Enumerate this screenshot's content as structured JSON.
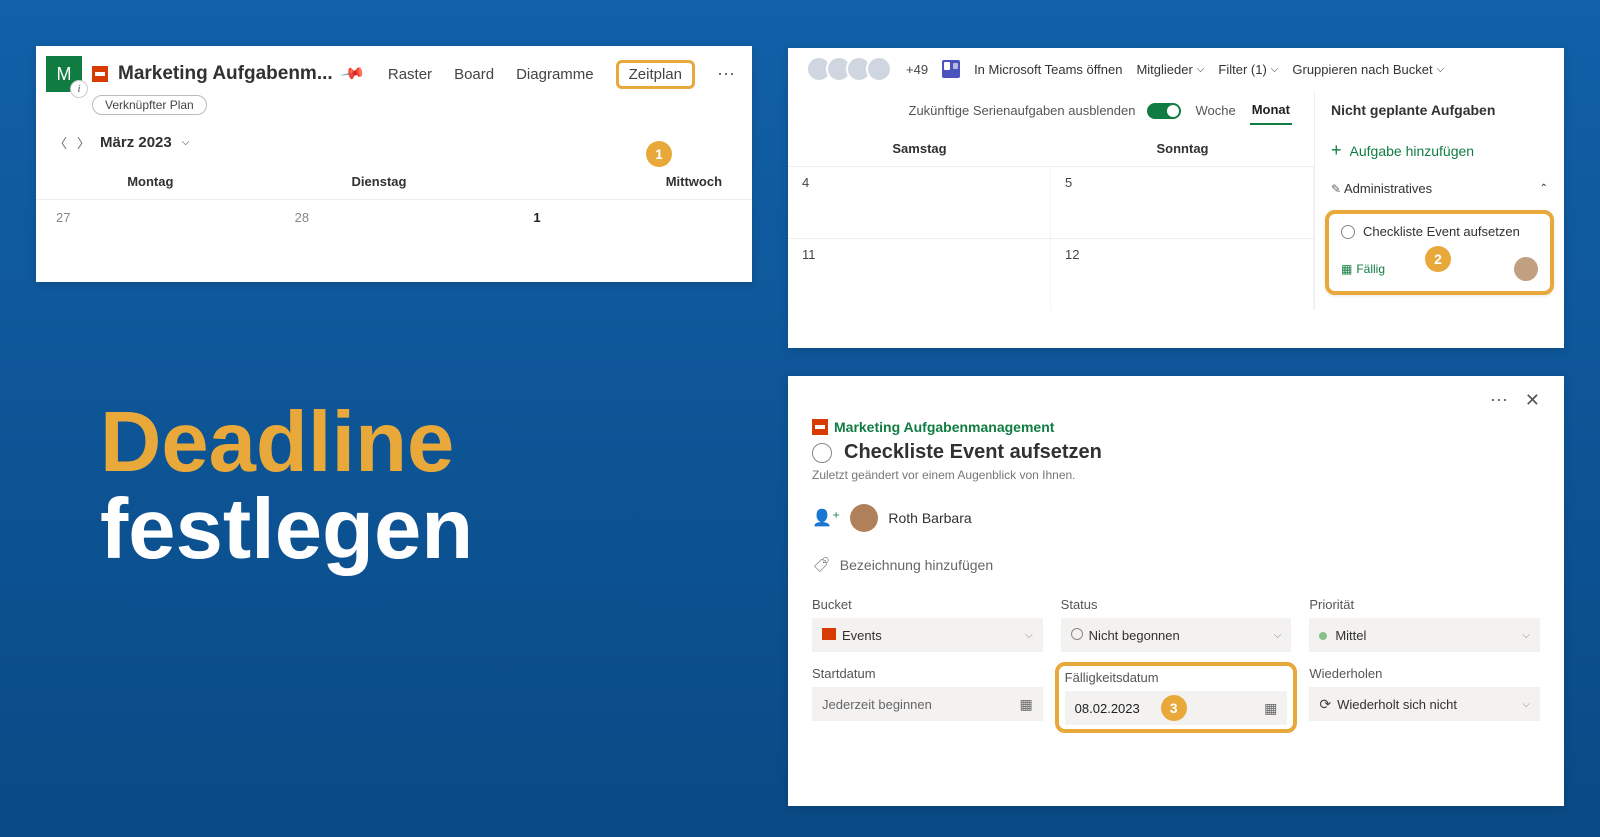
{
  "headline": {
    "line1": "Deadline",
    "line2": "festlegen"
  },
  "bubbles": {
    "one": "1",
    "two": "2",
    "three": "3"
  },
  "panel1": {
    "tile_letter": "M",
    "plan_title": "Marketing Aufgabenm...",
    "linked_plan": "Verknüpfter Plan",
    "tabs": {
      "raster": "Raster",
      "board": "Board",
      "diagramme": "Diagramme",
      "zeitplan": "Zeitplan"
    },
    "month_label": "März 2023",
    "days": {
      "mon": "Montag",
      "tue": "Dienstag",
      "wed": "Mittwoch"
    },
    "cells": {
      "c27": "27",
      "c28": "28",
      "c1": "1"
    }
  },
  "panel2": {
    "more_count": "+49",
    "open_teams": "In Microsoft Teams öffnen",
    "members": "Mitglieder",
    "filter": "Filter (1)",
    "group_by": "Gruppieren nach Bucket",
    "hide_recurring": "Zukünftige Serienaufgaben ausblenden",
    "week": "Woche",
    "month": "Monat",
    "sat": "Samstag",
    "sun": "Sonntag",
    "d4": "4",
    "d5": "5",
    "d11": "11",
    "d12": "12",
    "unplanned": "Nicht geplante Aufgaben",
    "add_task": "Aufgabe hinzufügen",
    "bucket_admin": "Administratives",
    "task_title": "Checkliste Event aufsetzen",
    "due_label": "Fällig"
  },
  "panel3": {
    "plan_name": "Marketing Aufgabenmanagement",
    "task_title": "Checkliste Event aufsetzen",
    "last_changed": "Zuletzt geändert vor einem Augenblick von Ihnen.",
    "assignee": "Roth Barbara",
    "add_label": "Bezeichnung hinzufügen",
    "bucket_l": "Bucket",
    "bucket_v": "Events",
    "status_l": "Status",
    "status_v": "Nicht begonnen",
    "prio_l": "Priorität",
    "prio_v": "Mittel",
    "start_l": "Startdatum",
    "start_ph": "Jederzeit beginnen",
    "due_l": "Fälligkeitsdatum",
    "due_v": "08.02.2023",
    "repeat_l": "Wiederholen",
    "repeat_v": "Wiederholt sich nicht"
  }
}
